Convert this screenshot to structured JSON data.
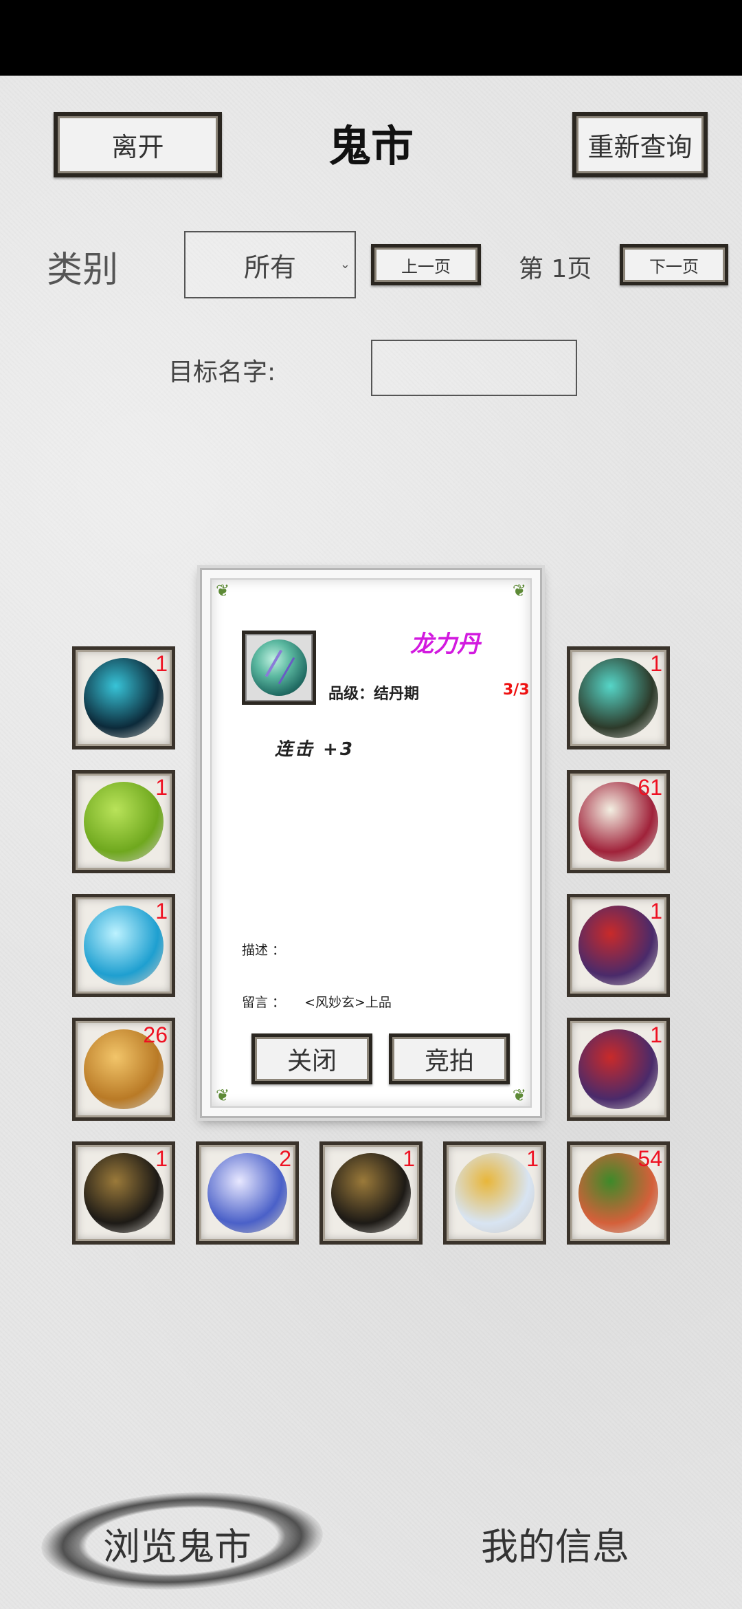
{
  "header": {
    "leave_label": "离开",
    "title": "鬼市",
    "requery_label": "重新查询"
  },
  "filters": {
    "category_label": "类别",
    "category_value": "所有",
    "prev_label": "上一页",
    "page_label": "第 1页",
    "next_label": "下一页",
    "target_label": "目标名字:",
    "target_value": ""
  },
  "slots": [
    {
      "item": "dark-gem",
      "count": "1",
      "colors": [
        "#0c2a3a",
        "#38c4d8"
      ]
    },
    {
      "item": "bead-necklace",
      "count": "1",
      "colors": [
        "#2d3a2a",
        "#56d6c8"
      ]
    },
    {
      "item": "green-bracers",
      "count": "1",
      "colors": [
        "#6fa81e",
        "#b9e35a"
      ]
    },
    {
      "item": "red-radish",
      "count": "61",
      "colors": [
        "#a0223a",
        "#f3efe2"
      ]
    },
    {
      "item": "ice-sword",
      "count": "1",
      "colors": [
        "#1e9fd0",
        "#bdf2ff"
      ]
    },
    {
      "item": "purple-boots",
      "count": "1",
      "colors": [
        "#4a2a6a",
        "#c92a2a"
      ]
    },
    {
      "item": "gold-ore",
      "count": "26",
      "colors": [
        "#b97a26",
        "#f2c56a"
      ]
    },
    {
      "item": "purple-boots-2",
      "count": "1",
      "colors": [
        "#4a2a6a",
        "#c92a2a"
      ]
    },
    {
      "item": "black-helmet",
      "count": "1",
      "colors": [
        "#1d1a16",
        "#9b7a3a"
      ]
    },
    {
      "item": "crystal-orb",
      "count": "2",
      "colors": [
        "#4a60c8",
        "#e8e8ff"
      ]
    },
    {
      "item": "black-helmet-2",
      "count": "1",
      "colors": [
        "#1d1a16",
        "#9b7a3a"
      ]
    },
    {
      "item": "white-armor",
      "count": "1",
      "colors": [
        "#d8e4f2",
        "#e8b63a"
      ]
    },
    {
      "item": "spiky-fruit",
      "count": "54",
      "colors": [
        "#d4603a",
        "#3e8a2a"
      ]
    }
  ],
  "popup": {
    "item_name": "龙力丹",
    "grade_label": "品级：结丹期",
    "grade_count": "3/3",
    "effect": "连击 +3",
    "desc_label": "描述  ：",
    "msg_label": "留言  ：",
    "msg_value": "<风妙玄>上品",
    "close_label": "关闭",
    "bid_label": "竞拍"
  },
  "bottom_nav": {
    "browse_label": "浏览鬼市",
    "info_label": "我的信息"
  }
}
